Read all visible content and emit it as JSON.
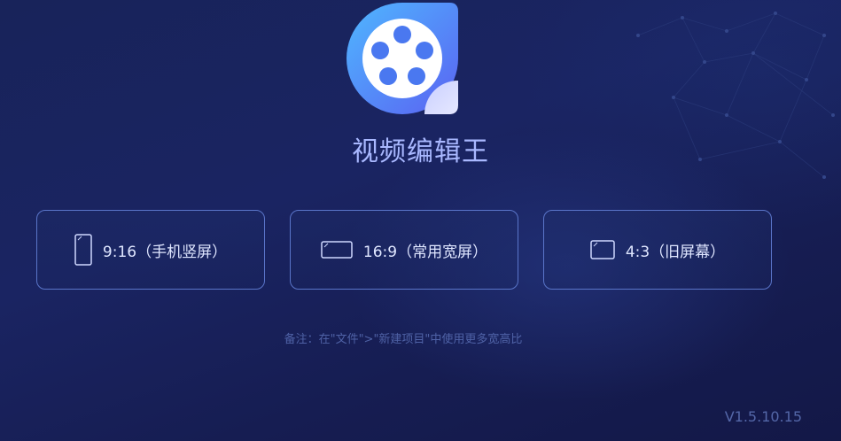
{
  "app": {
    "title": "视频编辑王",
    "logo_icon": "film-reel-icon",
    "version": "V1.5.10.15"
  },
  "ratios": [
    {
      "label": "9:16（手机竖屏）",
      "icon": "portrait-phone-icon"
    },
    {
      "label": "16:9（常用宽屏）",
      "icon": "landscape-screen-icon"
    },
    {
      "label": "4:3（旧屏幕）",
      "icon": "classic-screen-icon"
    }
  ],
  "note": "备注：在\"文件\">\"新建项目\"中使用更多宽高比",
  "colors": {
    "background": "#1a2462",
    "accent": "#5a75c9",
    "title": "#a9b8ff",
    "muted": "#4f62a6"
  }
}
